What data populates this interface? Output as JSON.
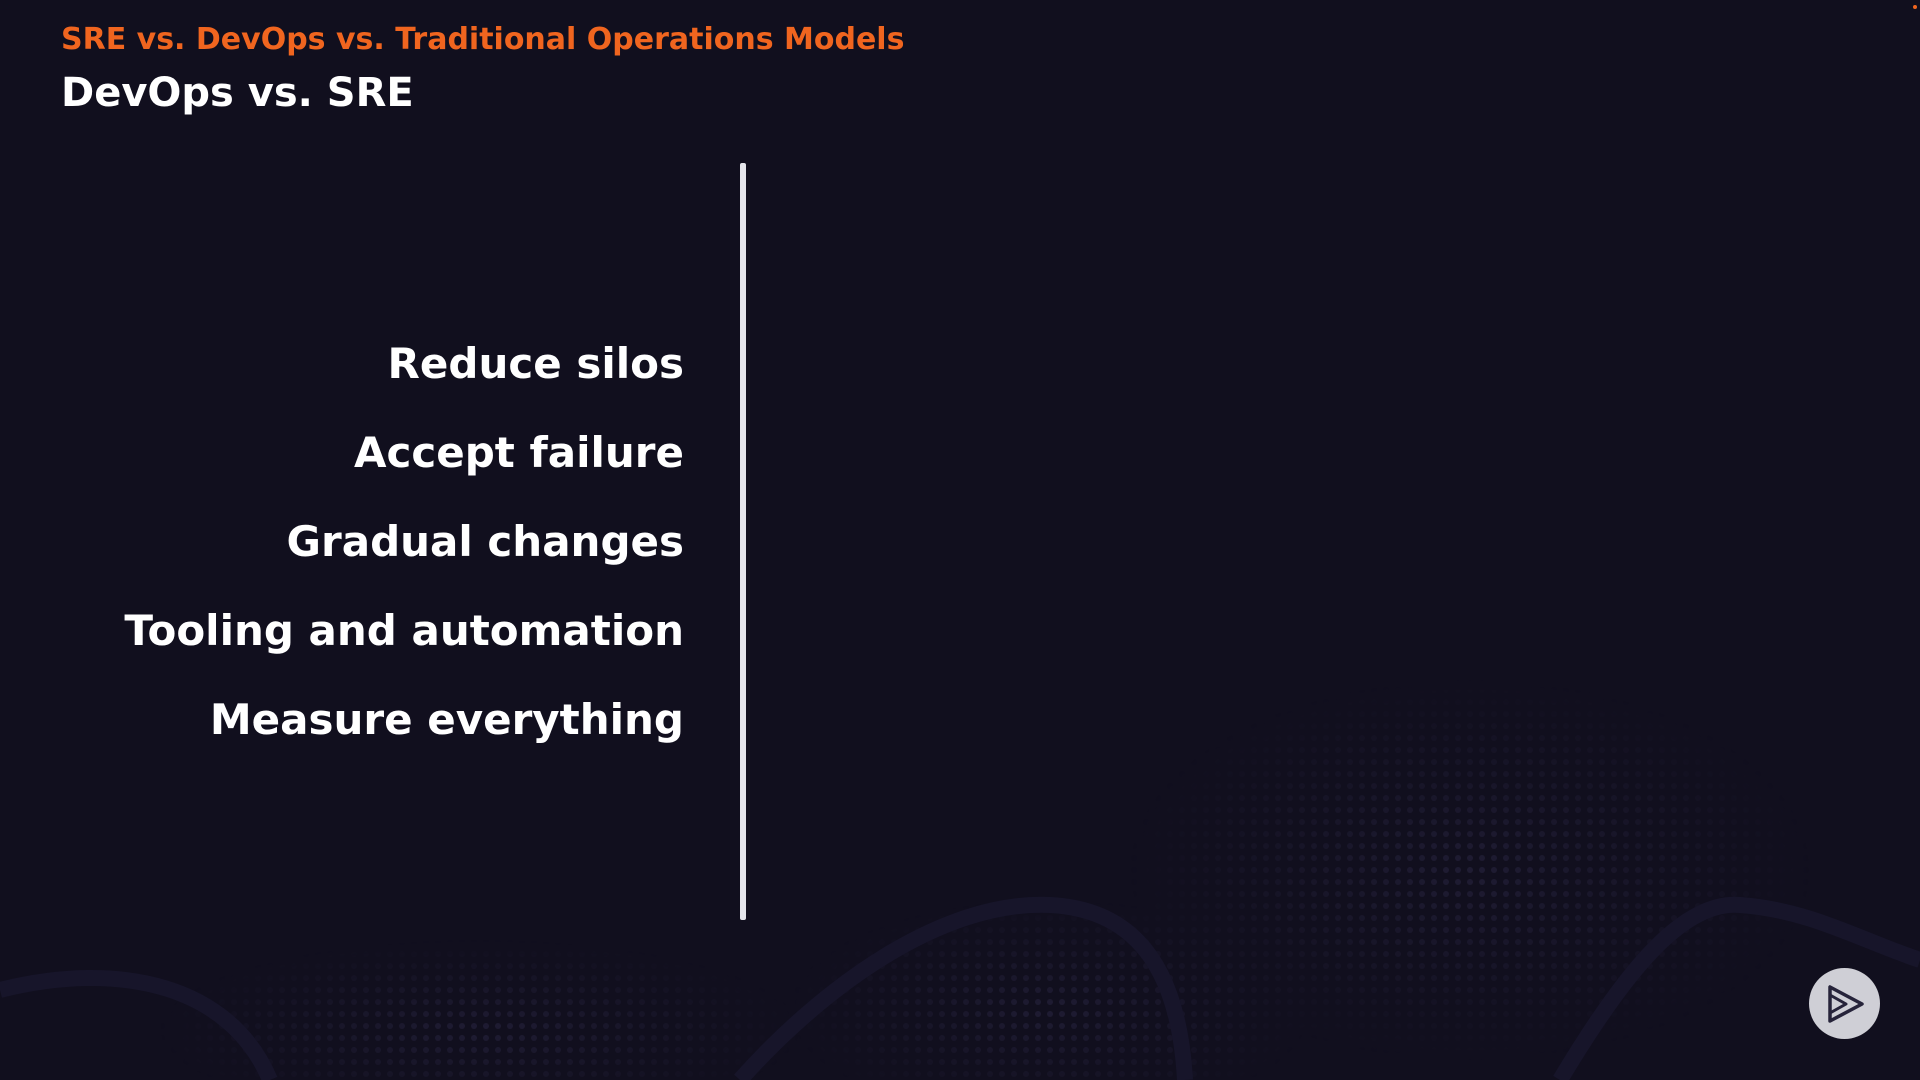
{
  "slide": {
    "section_title": "SRE vs. DevOps vs. Traditional Operations Models",
    "title": "DevOps vs. SRE",
    "points": [
      "Reduce silos",
      "Accept failure",
      "Gradual changes",
      "Tooling and automation",
      "Measure everything"
    ]
  },
  "colors": {
    "background": "#110f1e",
    "accent": "#f0651f",
    "text": "#ffffff",
    "divider": "#e6e6ec"
  },
  "icons": {
    "logo": "pluralsight-play-icon"
  }
}
